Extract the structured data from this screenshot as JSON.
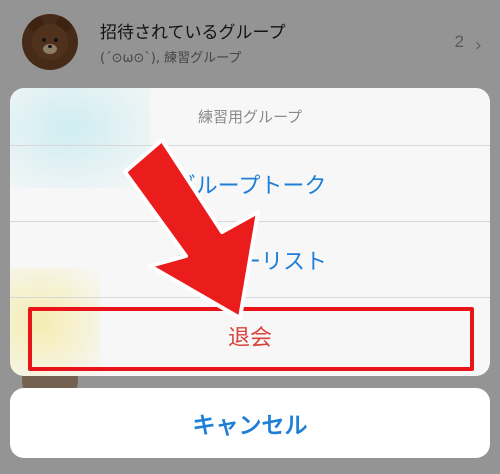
{
  "background": {
    "row": {
      "title": "招待されているグループ",
      "subtitle": "(´⊙ω⊙`), 練習グループ",
      "count": "2",
      "chevron": "›"
    }
  },
  "sheet": {
    "title": "練習用グループ",
    "items": [
      {
        "label": "グループトーク"
      },
      {
        "label": "メンバーリスト"
      },
      {
        "label": "退会"
      }
    ]
  },
  "cancel": {
    "label": "キャンセル"
  },
  "colors": {
    "accent": "#1e7fd6",
    "destructive": "#d9433b",
    "highlight": "#e8141a"
  },
  "icons": {
    "avatar": "bear-avatar-icon",
    "arrow": "down-arrow-icon"
  }
}
